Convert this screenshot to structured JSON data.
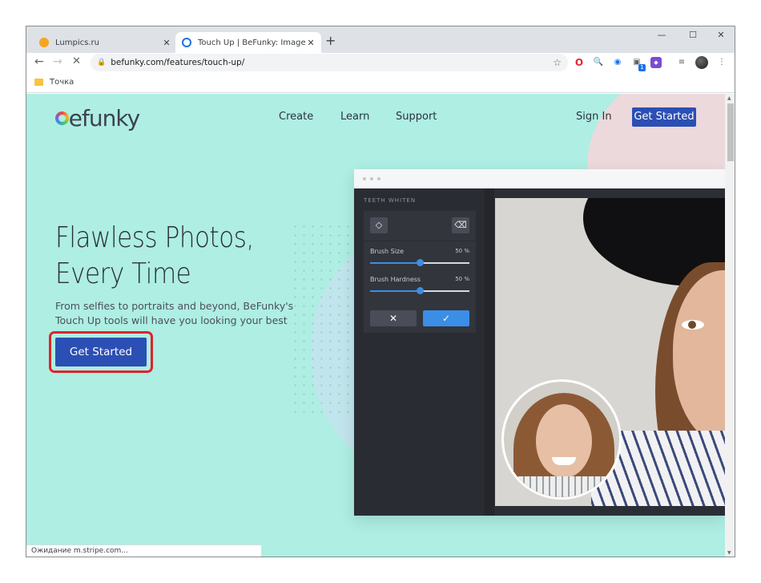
{
  "browser": {
    "tabs": [
      {
        "title": "Lumpics.ru",
        "active": false
      },
      {
        "title": "Touch Up | BeFunky: Image Retouch",
        "active": true
      }
    ],
    "new_tab_symbol": "+",
    "window_controls": [
      "—",
      "☐",
      "✕"
    ],
    "url": "befunky.com/features/touch-up/",
    "bookmark": "Точка",
    "status_text": "Ожидание m.stripe.com..."
  },
  "site": {
    "logo": "befunky",
    "nav": [
      "Create",
      "Learn",
      "Support"
    ],
    "sign_in": "Sign In",
    "get_started_nav": "Get Started",
    "hero_line1": "Flawless Photos,",
    "hero_line2": "Every Time",
    "subtitle_line1": "From selfies to portraits and beyond, BeFunky's",
    "subtitle_line2": "Touch Up tools will have you looking your best",
    "cta": "Get Started"
  },
  "editor": {
    "panel_title": "TEETH WHITEN",
    "brush_size_label": "Brush Size",
    "brush_size_value": "50 %",
    "brush_size_level": 0.5,
    "brush_hardness_label": "Brush Hardness",
    "brush_hardness_value": "50 %",
    "brush_hardness_level": 0.5,
    "cancel_symbol": "✕",
    "apply_symbol": "✓"
  },
  "colors": {
    "page_bg": "#aeeee3",
    "brand_blue": "#2b4fb4",
    "highlight_red": "#e0222b",
    "editor_dark": "#2c2e35",
    "slider_blue": "#3a8ee6"
  },
  "icons": [
    "back-arrow-icon",
    "forward-arrow-icon",
    "stop-icon",
    "lock-icon",
    "star-icon",
    "eraser-icon",
    "clear-icon",
    "close-icon",
    "check-icon",
    "folder-icon"
  ]
}
